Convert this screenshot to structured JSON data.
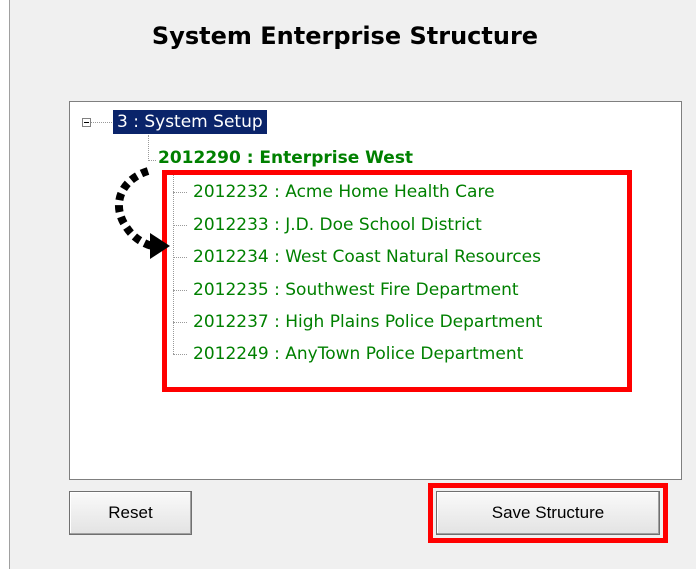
{
  "window": {
    "title": "System Enterprise Structure"
  },
  "tree": {
    "root": {
      "label": "3 : System Setup",
      "expanded": true
    },
    "enterprise": {
      "label": "2012290 : Enterprise  West"
    },
    "children": [
      {
        "label": "2012232 : Acme Home Health Care"
      },
      {
        "label": "2012233 : J.D. Doe School District"
      },
      {
        "label": "2012234 : West Coast Natural Resources"
      },
      {
        "label": "2012235 : Southwest Fire Department"
      },
      {
        "label": "2012237 : High Plains Police Department"
      },
      {
        "label": "2012249 : AnyTown Police Department"
      }
    ]
  },
  "buttons": {
    "reset_label": "Reset",
    "save_label": "Save Structure"
  },
  "colors": {
    "highlight": "#ff0000",
    "tree_text": "#008000",
    "selection": "#0a246a"
  }
}
